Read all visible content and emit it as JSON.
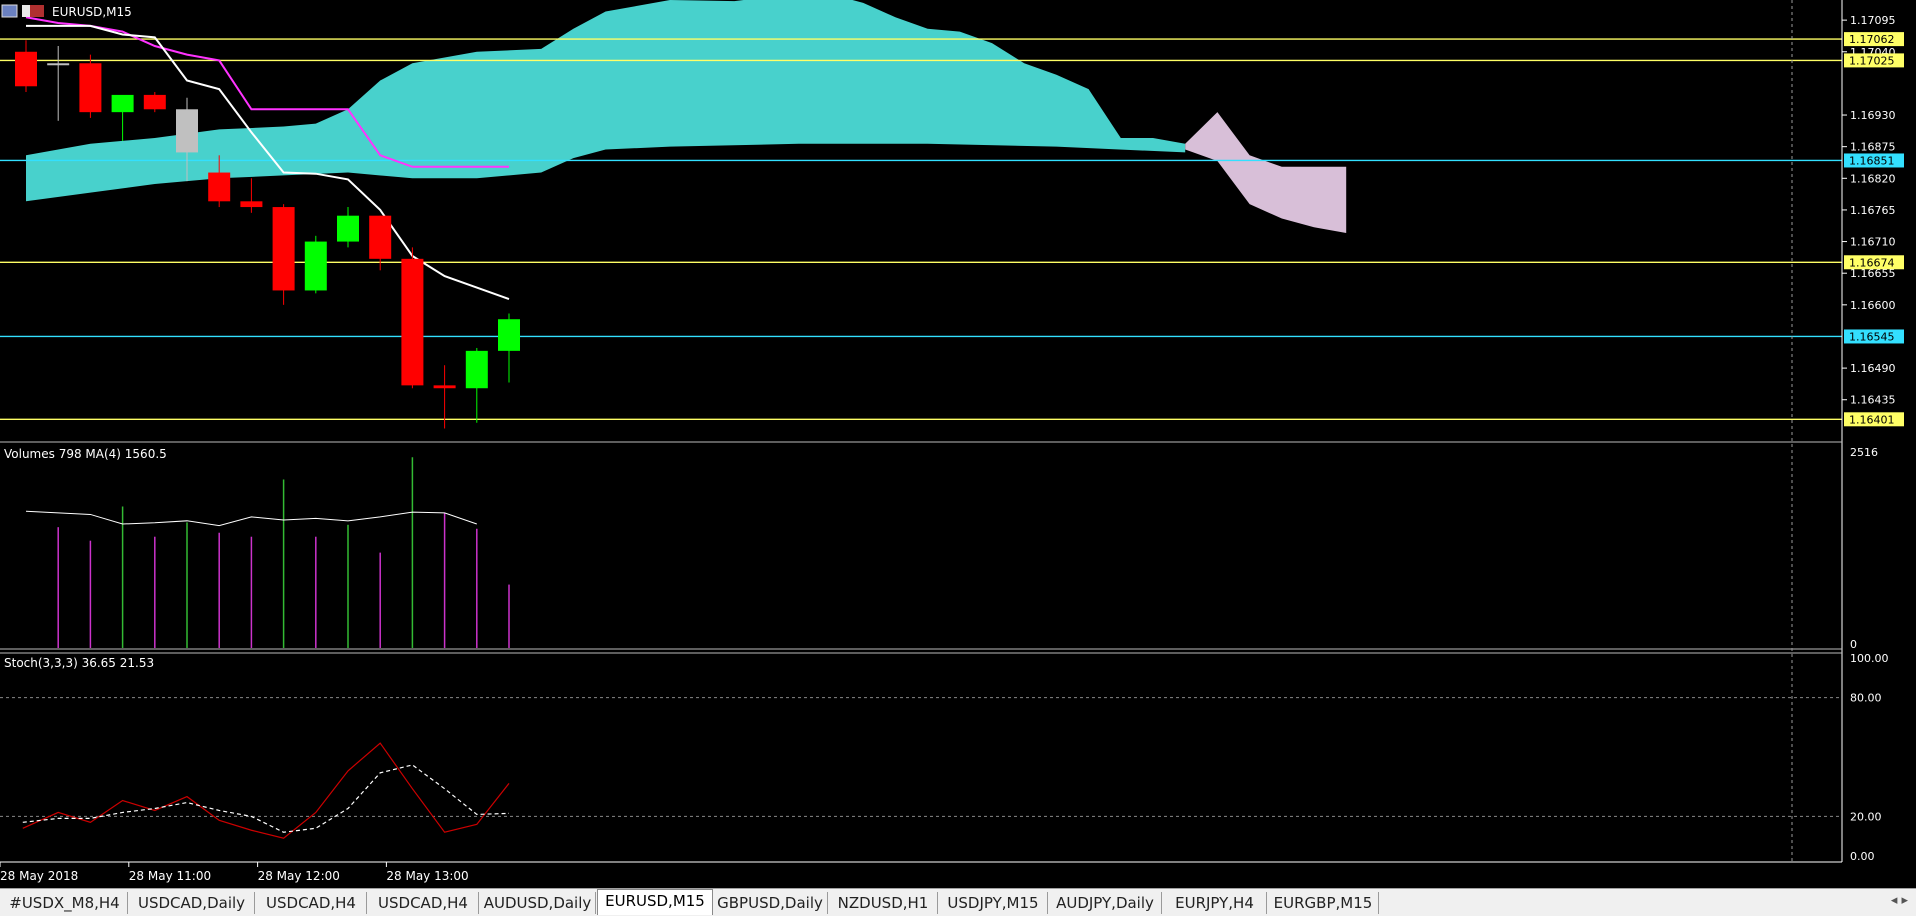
{
  "window": {
    "symbol_title": "EURUSD,M15"
  },
  "tabs": [
    {
      "label": "#USDX_M8,H4"
    },
    {
      "label": "USDCAD,Daily"
    },
    {
      "label": "USDCAD,H4"
    },
    {
      "label": "USDCAD,H4"
    },
    {
      "label": "AUDUSD,Daily"
    },
    {
      "label": "EURUSD,M15",
      "active": true
    },
    {
      "label": "GBPUSD,Daily"
    },
    {
      "label": "NZDUSD,H1"
    },
    {
      "label": "USDJPY,M15"
    },
    {
      "label": "AUDJPY,Daily"
    },
    {
      "label": "EURJPY,H4"
    },
    {
      "label": "EURGBP,M15"
    }
  ],
  "tab_arrows": "◂ ▸",
  "chart_data": [
    {
      "type": "candlestick",
      "title": "EURUSD,M15",
      "ylim": [
        1.16365,
        1.1713
      ],
      "y_ticks": [
        "1.17095",
        "1.17040",
        "1.16930",
        "1.16875",
        "1.16820",
        "1.16765",
        "1.16710",
        "1.16655",
        "1.16600",
        "1.16490",
        "1.16435"
      ],
      "x_ticks": [
        {
          "label": "28 May 2018",
          "bar": 0
        },
        {
          "label": "28 May 11:00",
          "bar": 4
        },
        {
          "label": "28 May 12:00",
          "bar": 8
        },
        {
          "label": "28 May 13:00",
          "bar": 12
        }
      ],
      "candles": [
        {
          "o": 1.1704,
          "h": 1.1706,
          "l": 1.1697,
          "c": 1.1698
        },
        {
          "o": 1.1702,
          "h": 1.1705,
          "l": 1.1692,
          "c": 1.1702
        },
        {
          "o": 1.1702,
          "h": 1.17035,
          "l": 1.16925,
          "c": 1.16935
        },
        {
          "o": 1.16935,
          "h": 1.1695,
          "l": 1.16885,
          "c": 1.16965
        },
        {
          "o": 1.16965,
          "h": 1.1697,
          "l": 1.16935,
          "c": 1.1694
        },
        {
          "o": 1.1694,
          "h": 1.1696,
          "l": 1.16815,
          "c": 1.16865
        },
        {
          "o": 1.1683,
          "h": 1.1686,
          "l": 1.1677,
          "c": 1.1678
        },
        {
          "o": 1.1678,
          "h": 1.1682,
          "l": 1.1676,
          "c": 1.1677
        },
        {
          "o": 1.1677,
          "h": 1.16775,
          "l": 1.166,
          "c": 1.16625
        },
        {
          "o": 1.16625,
          "h": 1.1672,
          "l": 1.1662,
          "c": 1.1671
        },
        {
          "o": 1.1671,
          "h": 1.1677,
          "l": 1.167,
          "c": 1.16755
        },
        {
          "o": 1.16755,
          "h": 1.16755,
          "l": 1.1666,
          "c": 1.1668
        },
        {
          "o": 1.1668,
          "h": 1.167,
          "l": 1.16455,
          "c": 1.1646
        },
        {
          "o": 1.1646,
          "h": 1.16495,
          "l": 1.16385,
          "c": 1.16455
        },
        {
          "o": 1.16455,
          "h": 1.16525,
          "l": 1.16395,
          "c": 1.1652
        },
        {
          "o": 1.1652,
          "h": 1.16585,
          "l": 1.16465,
          "c": 1.16575
        }
      ],
      "bear_color": "#ff0000",
      "bull_color": "#00ff00",
      "doji_color": "#c0c0c0",
      "horizontal_levels": [
        {
          "value": 1.17062,
          "label": "1.17062",
          "color": "#ffff66"
        },
        {
          "value": 1.17025,
          "label": "1.17025",
          "color": "#ffff66"
        },
        {
          "value": 1.16851,
          "label": "1.16851",
          "color": "#33e0ff"
        },
        {
          "value": 1.16674,
          "label": "1.16674",
          "color": "#ffff66"
        },
        {
          "value": 1.16545,
          "label": "1.16545",
          "color": "#33e0ff"
        },
        {
          "value": 1.16401,
          "label": "1.16401",
          "color": "#ffff66"
        }
      ],
      "ichimoku": {
        "kijun_color": "#ff33ff",
        "tenkan_color": "#ffffff",
        "kumo_bull_color": "#48d1cc",
        "kumo_bear_color": "#d8bfd8",
        "tenkan": [
          {
            "bar": 0,
            "v": 1.17085
          },
          {
            "bar": 2,
            "v": 1.17085
          },
          {
            "bar": 3,
            "v": 1.1707
          },
          {
            "bar": 4,
            "v": 1.17065
          },
          {
            "bar": 5,
            "v": 1.1699
          },
          {
            "bar": 6,
            "v": 1.16975
          },
          {
            "bar": 7,
            "v": 1.169
          },
          {
            "bar": 8,
            "v": 1.1683
          },
          {
            "bar": 9,
            "v": 1.16828
          },
          {
            "bar": 10,
            "v": 1.16818
          },
          {
            "bar": 11,
            "v": 1.16765
          },
          {
            "bar": 12,
            "v": 1.16685
          },
          {
            "bar": 13,
            "v": 1.1665
          },
          {
            "bar": 14,
            "v": 1.1663
          },
          {
            "bar": 15,
            "v": 1.1661
          }
        ],
        "kijun": [
          {
            "bar": 0,
            "v": 1.171
          },
          {
            "bar": 1,
            "v": 1.1709
          },
          {
            "bar": 2,
            "v": 1.17085
          },
          {
            "bar": 3,
            "v": 1.17075
          },
          {
            "bar": 4,
            "v": 1.1705
          },
          {
            "bar": 5,
            "v": 1.17035
          },
          {
            "bar": 6,
            "v": 1.17025
          },
          {
            "bar": 7,
            "v": 1.1694
          },
          {
            "bar": 8,
            "v": 1.1694
          },
          {
            "bar": 9,
            "v": 1.1694
          },
          {
            "bar": 10,
            "v": 1.1694
          },
          {
            "bar": 11,
            "v": 1.1686
          },
          {
            "bar": 12,
            "v": 1.1684
          },
          {
            "bar": 13,
            "v": 1.1684
          },
          {
            "bar": 14,
            "v": 1.1684
          },
          {
            "bar": 15,
            "v": 1.1684
          }
        ],
        "kumo_top": [
          {
            "bar": 0,
            "v": 1.1686
          },
          {
            "bar": 2,
            "v": 1.1688
          },
          {
            "bar": 4,
            "v": 1.1689
          },
          {
            "bar": 6,
            "v": 1.16905
          },
          {
            "bar": 8,
            "v": 1.1691
          },
          {
            "bar": 9,
            "v": 1.16915
          },
          {
            "bar": 10,
            "v": 1.1694
          },
          {
            "bar": 11,
            "v": 1.1699
          },
          {
            "bar": 12,
            "v": 1.1702
          },
          {
            "bar": 14,
            "v": 1.1704
          },
          {
            "bar": 16,
            "v": 1.17045
          },
          {
            "bar": 17,
            "v": 1.1708
          },
          {
            "bar": 18,
            "v": 1.1711
          },
          {
            "bar": 20,
            "v": 1.1713
          },
          {
            "bar": 22,
            "v": 1.17128
          },
          {
            "bar": 23,
            "v": 1.17135
          },
          {
            "bar": 24,
            "v": 1.17145
          },
          {
            "bar": 25,
            "v": 1.1714
          },
          {
            "bar": 26,
            "v": 1.17125
          },
          {
            "bar": 27,
            "v": 1.171
          },
          {
            "bar": 28,
            "v": 1.1708
          },
          {
            "bar": 29,
            "v": 1.17075
          },
          {
            "bar": 30,
            "v": 1.17055
          },
          {
            "bar": 31,
            "v": 1.1702
          },
          {
            "bar": 32,
            "v": 1.17
          },
          {
            "bar": 33,
            "v": 1.16975
          },
          {
            "bar": 34,
            "v": 1.1689
          },
          {
            "bar": 35,
            "v": 1.1689
          },
          {
            "bar": 36,
            "v": 1.1688
          }
        ],
        "kumo_bottom": [
          {
            "bar": 0,
            "v": 1.1678
          },
          {
            "bar": 2,
            "v": 1.16795
          },
          {
            "bar": 4,
            "v": 1.1681
          },
          {
            "bar": 6,
            "v": 1.1682
          },
          {
            "bar": 8,
            "v": 1.16825
          },
          {
            "bar": 10,
            "v": 1.1683
          },
          {
            "bar": 12,
            "v": 1.1682
          },
          {
            "bar": 14,
            "v": 1.1682
          },
          {
            "bar": 16,
            "v": 1.1683
          },
          {
            "bar": 17,
            "v": 1.16855
          },
          {
            "bar": 18,
            "v": 1.1687
          },
          {
            "bar": 20,
            "v": 1.16875
          },
          {
            "bar": 24,
            "v": 1.1688
          },
          {
            "bar": 28,
            "v": 1.1688
          },
          {
            "bar": 32,
            "v": 1.16875
          },
          {
            "bar": 36,
            "v": 1.16865
          }
        ],
        "kumo_bear_top": [
          {
            "bar": 36,
            "v": 1.1688
          },
          {
            "bar": 37,
            "v": 1.16935
          },
          {
            "bar": 38,
            "v": 1.1686
          },
          {
            "bar": 39,
            "v": 1.1684
          },
          {
            "bar": 41,
            "v": 1.1684
          }
        ],
        "kumo_bear_bottom": [
          {
            "bar": 36,
            "v": 1.1687
          },
          {
            "bar": 37,
            "v": 1.1685
          },
          {
            "bar": 38,
            "v": 1.16775
          },
          {
            "bar": 39,
            "v": 1.1675
          },
          {
            "bar": 40,
            "v": 1.16735
          },
          {
            "bar": 41,
            "v": 1.16725
          }
        ]
      }
    },
    {
      "type": "bar",
      "title": "Volumes 798 MA(4) 1560.5",
      "ylim": [
        0,
        2516
      ],
      "y_ticks": [
        "2516",
        "0"
      ],
      "bars": [
        {
          "bar": 1,
          "v": 1520,
          "color": "#cc33cc"
        },
        {
          "bar": 2,
          "v": 1350,
          "color": "#cc33cc"
        },
        {
          "bar": 3,
          "v": 1780,
          "color": "#33bb33"
        },
        {
          "bar": 4,
          "v": 1400,
          "color": "#cc33cc"
        },
        {
          "bar": 5,
          "v": 1580,
          "color": "#33bb33"
        },
        {
          "bar": 6,
          "v": 1450,
          "color": "#cc33cc"
        },
        {
          "bar": 7,
          "v": 1400,
          "color": "#cc33cc"
        },
        {
          "bar": 8,
          "v": 2120,
          "color": "#33bb33"
        },
        {
          "bar": 9,
          "v": 1400,
          "color": "#cc33cc"
        },
        {
          "bar": 10,
          "v": 1550,
          "color": "#33bb33"
        },
        {
          "bar": 11,
          "v": 1200,
          "color": "#cc33cc"
        },
        {
          "bar": 12,
          "v": 2400,
          "color": "#33bb33"
        },
        {
          "bar": 13,
          "v": 1700,
          "color": "#cc33cc"
        },
        {
          "bar": 14,
          "v": 1500,
          "color": "#cc33cc"
        },
        {
          "bar": 15,
          "v": 798,
          "color": "#cc33cc"
        }
      ],
      "ma": [
        {
          "bar": 0,
          "v": 1720
        },
        {
          "bar": 1,
          "v": 1700
        },
        {
          "bar": 2,
          "v": 1680
        },
        {
          "bar": 3,
          "v": 1560
        },
        {
          "bar": 4,
          "v": 1575
        },
        {
          "bar": 5,
          "v": 1600
        },
        {
          "bar": 6,
          "v": 1540
        },
        {
          "bar": 7,
          "v": 1650
        },
        {
          "bar": 8,
          "v": 1610
        },
        {
          "bar": 9,
          "v": 1630
        },
        {
          "bar": 10,
          "v": 1600
        },
        {
          "bar": 11,
          "v": 1650
        },
        {
          "bar": 12,
          "v": 1710
        },
        {
          "bar": 13,
          "v": 1700
        },
        {
          "bar": 14,
          "v": 1560
        }
      ],
      "ma_color": "#ffffff"
    },
    {
      "type": "line",
      "title": "Stoch(3,3,3) 36.65 21.53",
      "ylim": [
        0,
        100
      ],
      "y_ticks": [
        "100.00",
        "80.00",
        "20.00",
        "0.00"
      ],
      "levels": [
        80,
        20
      ],
      "series": [
        {
          "color": "#cc0000",
          "dashed": false,
          "points": [
            {
              "bar": -0.1,
              "v": 14
            },
            {
              "bar": 1,
              "v": 22
            },
            {
              "bar": 2,
              "v": 17
            },
            {
              "bar": 3,
              "v": 28
            },
            {
              "bar": 4,
              "v": 23
            },
            {
              "bar": 5,
              "v": 30
            },
            {
              "bar": 6,
              "v": 18
            },
            {
              "bar": 7,
              "v": 13
            },
            {
              "bar": 8,
              "v": 9
            },
            {
              "bar": 9,
              "v": 22
            },
            {
              "bar": 10,
              "v": 43
            },
            {
              "bar": 11,
              "v": 57
            },
            {
              "bar": 12,
              "v": 34
            },
            {
              "bar": 13,
              "v": 12
            },
            {
              "bar": 14,
              "v": 16
            },
            {
              "bar": 15,
              "v": 36.65
            }
          ]
        },
        {
          "color": "#ffffff",
          "dashed": true,
          "points": [
            {
              "bar": -0.1,
              "v": 17
            },
            {
              "bar": 1,
              "v": 19
            },
            {
              "bar": 2,
              "v": 19
            },
            {
              "bar": 3,
              "v": 22
            },
            {
              "bar": 4,
              "v": 24
            },
            {
              "bar": 5,
              "v": 27
            },
            {
              "bar": 6,
              "v": 23
            },
            {
              "bar": 7,
              "v": 20
            },
            {
              "bar": 8,
              "v": 12
            },
            {
              "bar": 9,
              "v": 14
            },
            {
              "bar": 10,
              "v": 24
            },
            {
              "bar": 11,
              "v": 42
            },
            {
              "bar": 12,
              "v": 46
            },
            {
              "bar": 13,
              "v": 34
            },
            {
              "bar": 14,
              "v": 21
            },
            {
              "bar": 15,
              "v": 21.53
            }
          ]
        }
      ]
    }
  ]
}
